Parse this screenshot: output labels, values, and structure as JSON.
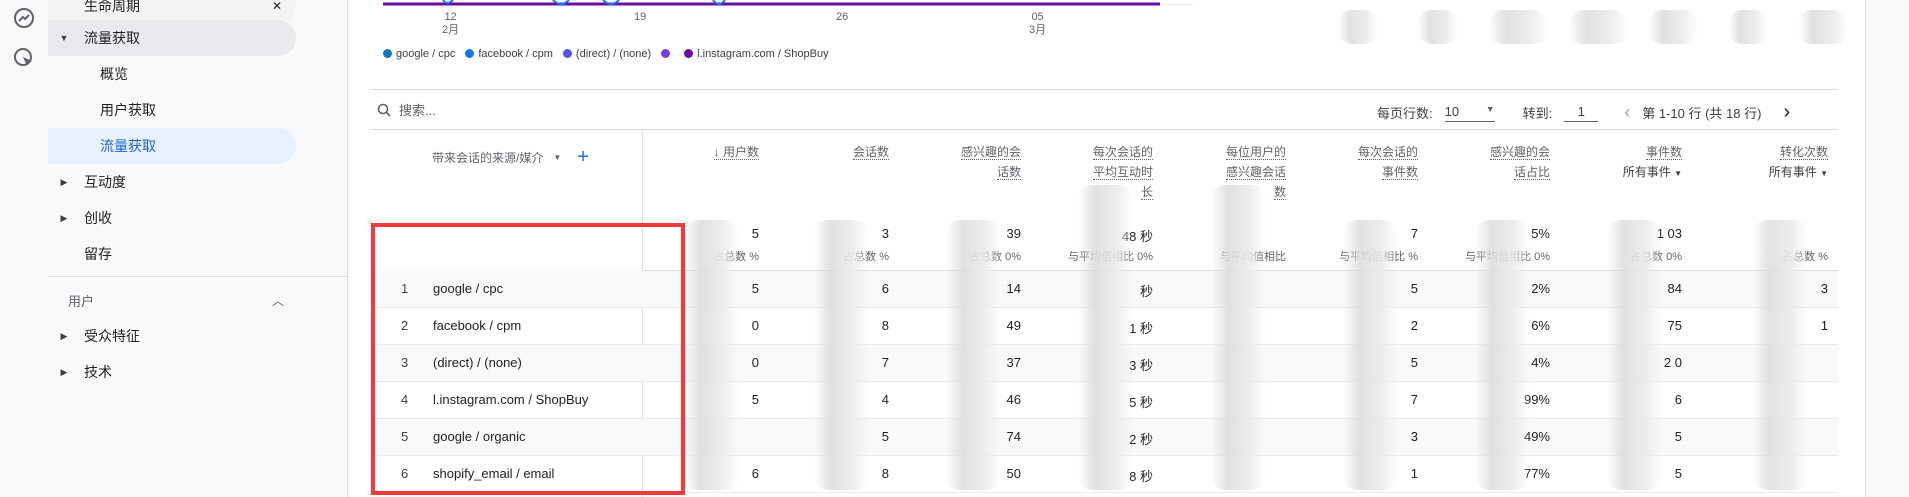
{
  "sidebar": {
    "top_partial": "生命周期",
    "items": [
      {
        "label": "流量获取",
        "expanded": true
      },
      {
        "label": "概览"
      },
      {
        "label": "用户获取"
      },
      {
        "label": "流量获取",
        "selected": true
      },
      {
        "label": "互动度"
      },
      {
        "label": "创收"
      },
      {
        "label": "留存"
      }
    ],
    "section2": "用户",
    "items2": [
      {
        "label": "受众特征"
      },
      {
        "label": "技术"
      }
    ]
  },
  "chart": {
    "x_ticks": [
      {
        "day": "12",
        "month": "2月"
      },
      {
        "day": "19",
        "month": ""
      },
      {
        "day": "26",
        "month": ""
      },
      {
        "day": "05",
        "month": "3月"
      }
    ],
    "legend": [
      {
        "label": "google / cpc",
        "color": "#1279b8"
      },
      {
        "label": "facebook / cpm",
        "color": "#1a73e8"
      },
      {
        "label": "(direct) / (none)",
        "color": "#5254e8"
      },
      {
        "label": "",
        "color": "#7b3fd6"
      },
      {
        "label": "l.instagram.com / ShopBuy",
        "color": "#6a0d9e"
      }
    ]
  },
  "toolbar": {
    "search_placeholder": "搜索...",
    "rows_per_page_label": "每页行数:",
    "rows_per_page": "10",
    "goto_label": "转到:",
    "goto_value": "1",
    "range_text": "第 1-10 行 (共 18 行)"
  },
  "table": {
    "dimension_header": "带来会话的来源/媒介",
    "columns": [
      {
        "lines": [
          "↓ 用户数"
        ],
        "sub": "占总数",
        "total": "5",
        "total_pct": "%"
      },
      {
        "lines": [
          "会话数"
        ],
        "sub": "占总数",
        "total": "3",
        "total_pct": "%"
      },
      {
        "lines": [
          "感兴趣的会",
          "话数"
        ],
        "sub": "占总数",
        "total": "39",
        "total_pct": "0%"
      },
      {
        "lines": [
          "每次会话的",
          "平均互动时",
          "长"
        ],
        "sub": "与平均值相比",
        "total": "48 秒",
        "total_pct": "0%"
      },
      {
        "lines": [
          "每位用户的",
          "感兴趣会话",
          "数"
        ],
        "sub": "与平均值相比",
        "total": "",
        "total_pct": ""
      },
      {
        "lines": [
          "每次会话的",
          "事件数"
        ],
        "sub": "与平均值相比",
        "total": "7",
        "total_pct": "%"
      },
      {
        "lines": [
          "感兴趣的会",
          "话占比"
        ],
        "sub": "与平均值相比",
        "total": "5%",
        "total_pct": "0%"
      },
      {
        "lines": [
          "事件数"
        ],
        "dropdown": "所有事件",
        "sub": "占总数",
        "total": "1 03",
        "total_pct": "0%"
      },
      {
        "lines": [
          "转化次数"
        ],
        "dropdown": "所有事件",
        "sub": "占总数",
        "total": "",
        "total_pct": "%"
      }
    ],
    "rows": [
      {
        "n": "1",
        "dim": "google / cpc",
        "cells": [
          "5",
          "6",
          "14",
          "秒",
          "",
          "5",
          "2%",
          "84",
          "3"
        ]
      },
      {
        "n": "2",
        "dim": "facebook / cpm",
        "cells": [
          "0",
          "8",
          "49",
          "1 秒",
          "",
          "2",
          "6%",
          "75",
          "1"
        ]
      },
      {
        "n": "3",
        "dim": "(direct) / (none)",
        "cells": [
          "0",
          "7",
          "37",
          "3 秒",
          "",
          "5",
          "4%",
          "2 0",
          ""
        ]
      },
      {
        "n": "4",
        "dim": "l.instagram.com / ShopBuy",
        "cells": [
          "5",
          "4",
          "46",
          "5 秒",
          "",
          "7",
          "99%",
          "6",
          ""
        ]
      },
      {
        "n": "5",
        "dim": "google / organic",
        "cells": [
          "",
          "5",
          "74",
          "2 秒",
          "",
          "3",
          "49%",
          "5",
          ""
        ]
      },
      {
        "n": "6",
        "dim": "shopify_email / email",
        "cells": [
          "6",
          "8",
          "50",
          "8 秒",
          "",
          "1",
          "77%",
          "5",
          ""
        ]
      }
    ]
  },
  "colors": {
    "accent": "#1a73e8",
    "highlight_box": "#f23a3a",
    "selected_nav_bg": "#e8f0fe"
  }
}
